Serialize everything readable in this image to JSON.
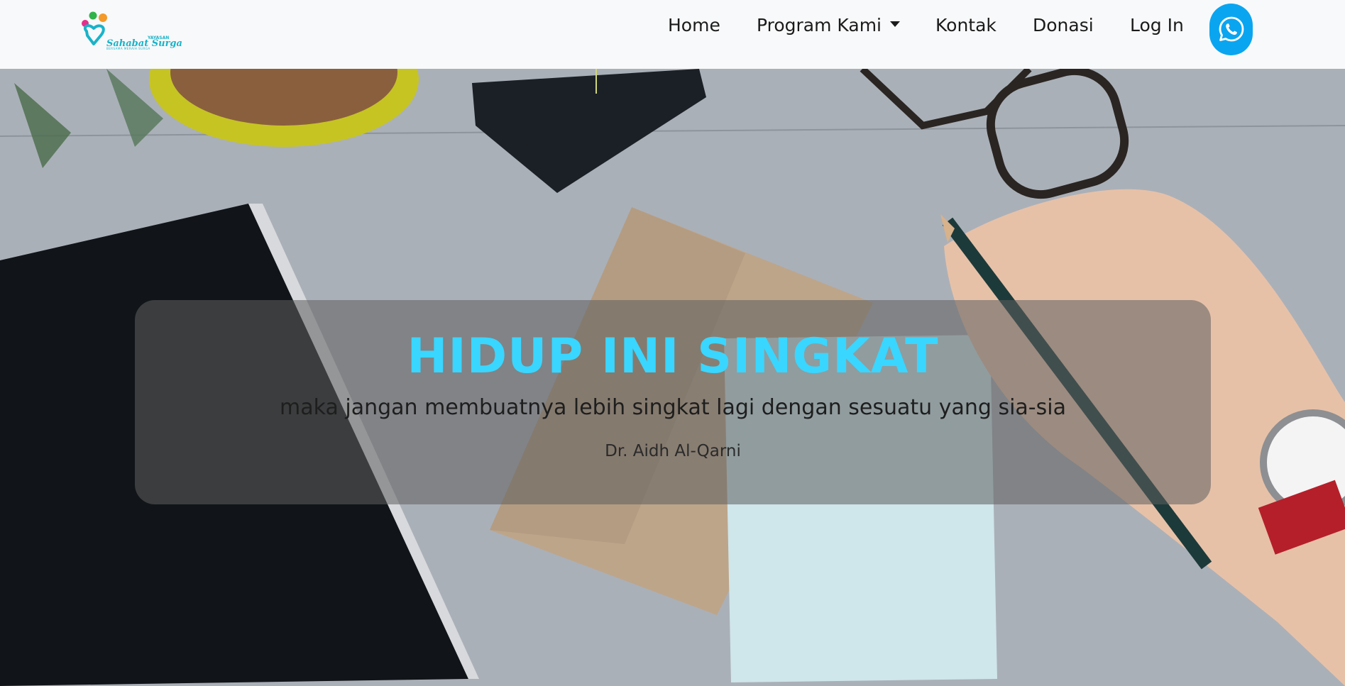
{
  "navbar": {
    "logo": {
      "yayasan": "YAYASAN",
      "brand": "Sahabat Surga",
      "tagline": "BERSAMA MERAIH SURGA"
    },
    "links": {
      "home": "Home",
      "program": "Program Kami",
      "kontak": "Kontak",
      "donasi": "Donasi",
      "login": "Log In"
    },
    "whatsapp_icon": "whatsapp-icon"
  },
  "hero": {
    "title": "HIDUP INI SINGKAT",
    "quote": "maka jangan membuatnya lebih singkat lagi dengan sesuatu yang sia-sia",
    "author": "Dr. Aidh Al-Qarni"
  },
  "colors": {
    "accent_cyan": "#39d6ff",
    "whatsapp_blue": "#0aa5f0",
    "logo_teal": "#19b3c9"
  }
}
